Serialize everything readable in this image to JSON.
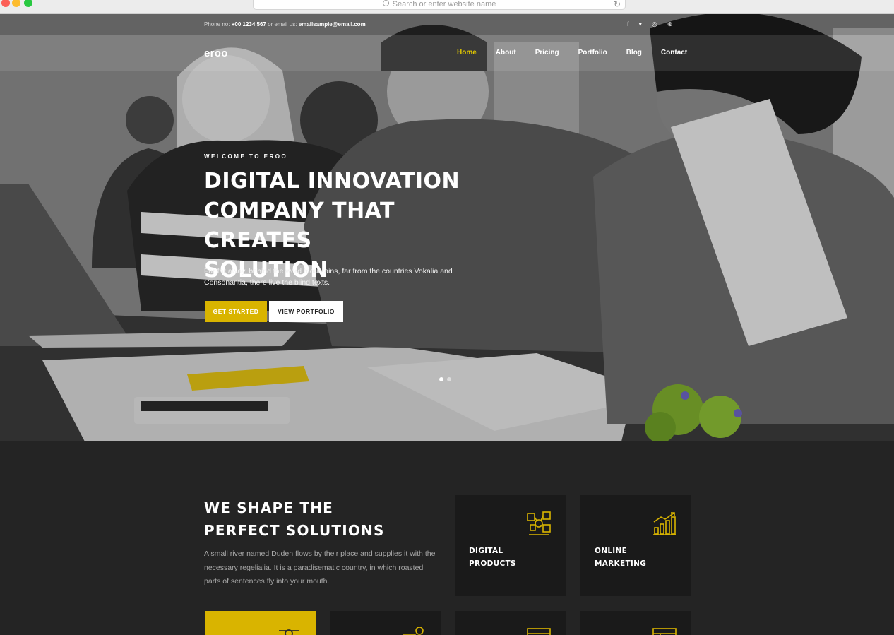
{
  "browser": {
    "address_placeholder": "Search or enter website name",
    "reload_icon": "reload-icon"
  },
  "topbar": {
    "phone_prefix": "Phone no:",
    "phone": "+00 1234 567",
    "or_email": "or email us:",
    "email": "emailsample@email.com",
    "social": [
      "facebook-icon",
      "twitter-icon",
      "instagram-icon",
      "dribbble-icon"
    ]
  },
  "header": {
    "logo": "eroo",
    "nav": [
      {
        "label": "Home",
        "active": true
      },
      {
        "label": "About",
        "active": false
      },
      {
        "label": "Pricing",
        "active": false
      },
      {
        "label": "Portfolio",
        "active": false
      },
      {
        "label": "Blog",
        "active": false
      },
      {
        "label": "Contact",
        "active": false
      }
    ]
  },
  "hero": {
    "eyebrow": "WELCOME TO EROO",
    "headline_lines": [
      "DIGITAL INNOVATION",
      "COMPANY THAT CREATES",
      "SOLUTION"
    ],
    "lead": "Far far away, behind the word mountains, far from the countries Vokalia and Consonantia, there live the blind texts.",
    "primary_button": "GET STARTED",
    "secondary_button": "VIEW PORTFOLIO"
  },
  "services": {
    "title_lines": [
      "WE SHAPE THE",
      "PERFECT SOLUTIONS"
    ],
    "text": "A small river named Duden flows by their place and supplies it with the necessary regelialia. It is a paradisematic country, in which roasted parts of sentences fly into your mouth.",
    "cards": [
      {
        "label_lines": [
          "DIGITAL",
          "PRODUCTS"
        ],
        "icon": "digital-products-icon"
      },
      {
        "label_lines": [
          "ONLINE",
          "MARKETING"
        ],
        "icon": "growth-chart-icon"
      }
    ]
  },
  "colors": {
    "accent": "#d9b400",
    "dark_bg": "#242424",
    "card_bg": "#1a1a1a"
  }
}
